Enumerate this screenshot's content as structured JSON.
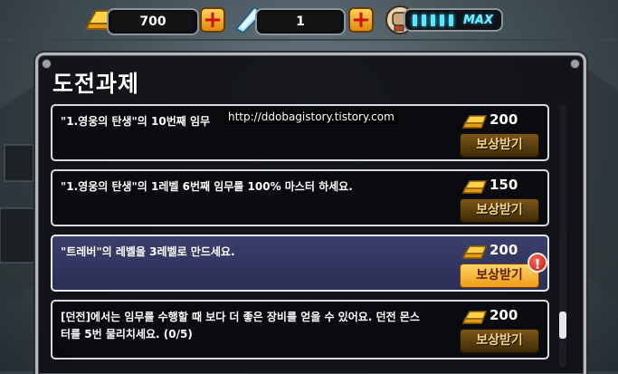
{
  "resources": {
    "gold": "700",
    "crystal": "1",
    "stamina_label": "MAX",
    "stamina_segments": 5
  },
  "panel": {
    "title": "도전과제"
  },
  "quests": [
    {
      "text": "\"1.영웅의 탄생\"의 10번째 임무",
      "reward": "200",
      "button": "보상받기",
      "highlight": false,
      "alert": false
    },
    {
      "text": "\"1.영웅의 탄생\"의 1레벨 6번째 임무를 100% 마스터 하세요.",
      "reward": "150",
      "button": "보상받기",
      "highlight": false,
      "alert": false
    },
    {
      "text": "\"트레버\"의 레벨을 3레벨로 만드세요.",
      "reward": "200",
      "button": "보상받기",
      "highlight": true,
      "alert": true,
      "alert_mark": "!"
    },
    {
      "text": "[던전]에서는 임무를 수행할 때 보다 더 좋은 장비를 얻을 수 있어요. 던전 몬스터를 5번 물리치세요. (0/5)",
      "reward": "200",
      "button": "보상받기",
      "highlight": false,
      "alert": false
    }
  ],
  "watermark": "http://ddobagistory.tistory.com",
  "plus_symbol": "+"
}
